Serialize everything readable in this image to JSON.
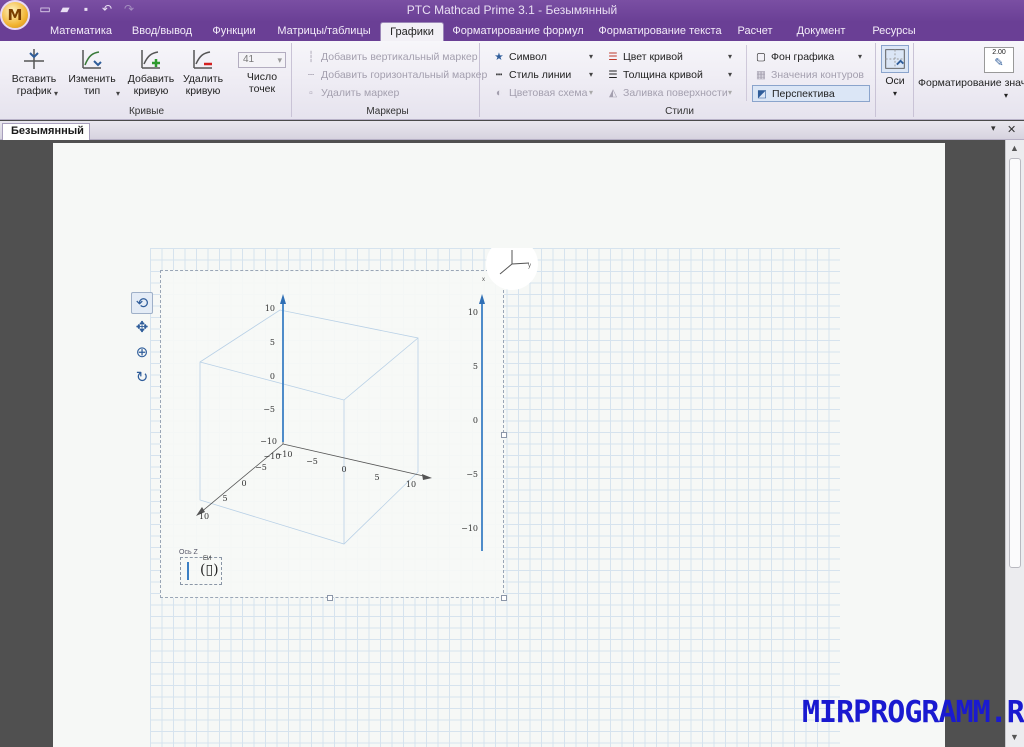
{
  "window": {
    "title": "PTC Mathcad Prime 3.1 - Безымянный",
    "orb_letter": "M"
  },
  "tabs": [
    {
      "label": "Математика",
      "active": false
    },
    {
      "label": "Ввод/вывод",
      "active": false
    },
    {
      "label": "Функции",
      "active": false
    },
    {
      "label": "Матрицы/таблицы",
      "active": false
    },
    {
      "label": "Графики",
      "active": true
    },
    {
      "label": "Форматирование формул",
      "active": false
    },
    {
      "label": "Форматирование текста",
      "active": false
    },
    {
      "label": "Расчет",
      "active": false
    },
    {
      "label": "Документ",
      "active": false
    },
    {
      "label": "Ресурсы",
      "active": false
    }
  ],
  "ribbon": {
    "curves": {
      "group_label": "Кривые",
      "insert_plot_l1": "Вставить",
      "insert_plot_l2": "график",
      "change_type_l1": "Изменить",
      "change_type_l2": "тип",
      "add_curve_l1": "Добавить",
      "add_curve_l2": "кривую",
      "delete_curve_l1": "Удалить",
      "delete_curve_l2": "кривую",
      "points_value": "41",
      "points_l1": "Число",
      "points_l2": "точек"
    },
    "markers": {
      "group_label": "Маркеры",
      "add_vertical": "Добавить вертикальный маркер",
      "add_horizontal": "Добавить горизонтальный маркер",
      "delete_marker": "Удалить маркер"
    },
    "styles": {
      "group_label": "Стили",
      "symbol": "Символ",
      "line_style": "Стиль линии",
      "color_scheme": "Цветовая схема",
      "curve_color": "Цвет кривой",
      "curve_thickness": "Толщина кривой",
      "surface_fill": "Заливка поверхности",
      "plot_background": "Фон графика",
      "contour_values": "Значения контуров",
      "perspective": "Перспектива"
    },
    "axes": {
      "label": "Оси"
    },
    "value_format": {
      "label": "Форматирование значе",
      "sample": "2.00"
    }
  },
  "document": {
    "tab_title": "Безымянный"
  },
  "plot": {
    "x_ticks": [
      "10",
      "5",
      "0",
      "−5",
      "−10"
    ],
    "y_ticks": [
      "−10",
      "−5",
      "0",
      "5",
      "10"
    ],
    "z_ticks": [
      "10",
      "5",
      "0",
      "−5",
      "−10"
    ],
    "scale_ticks": [
      "10",
      "5",
      "0",
      "−5",
      "−10"
    ],
    "triad": {
      "x": "x",
      "y": "y"
    },
    "legend": {
      "caption": "Ось Z",
      "unit": "ЕИ",
      "placeholder": "(▯)"
    }
  },
  "watermark": "MIRPROGRAMM.RU"
}
